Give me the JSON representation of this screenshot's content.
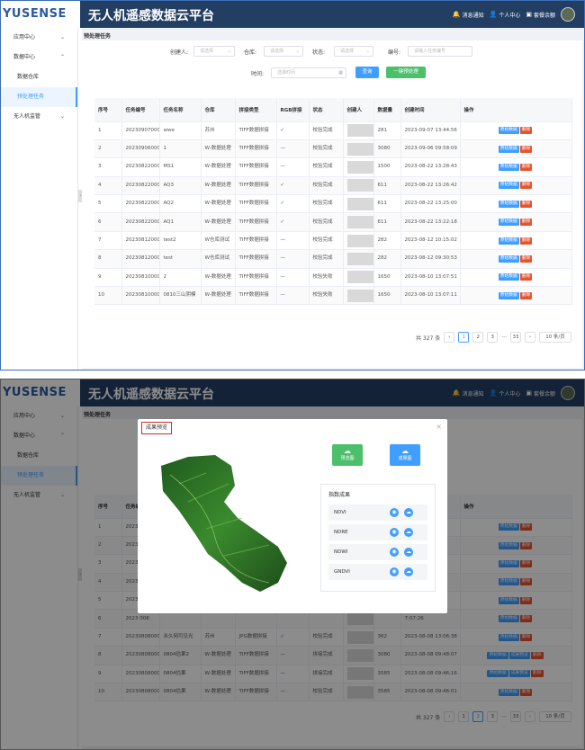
{
  "app": {
    "logo": "YUSENSE",
    "title": "无人机遥感数据云平台"
  },
  "header": {
    "notify": "消息通知",
    "personal": "个人中心",
    "account": "套餐余额"
  },
  "sidebar": {
    "app_center": "应用中心",
    "data_center": "数据中心",
    "warehouse": "数据仓库",
    "pretask": "预处理任务",
    "uav_monitor": "无人机监管"
  },
  "page": {
    "breadcrumb": "预处理任务"
  },
  "filters": {
    "creator_label": "创建人:",
    "creator_placeholder": "请选择",
    "warehouse_label": "仓库:",
    "warehouse_placeholder": "请选择",
    "status_label": "状态:",
    "status_placeholder": "请选择",
    "id_label": "编号:",
    "id_placeholder": "请输入任务编号",
    "time_label": "时间:",
    "time_placeholder": "选择时间",
    "query": "查询",
    "one_click": "一键预处理"
  },
  "table": {
    "headers": [
      "序号",
      "任务编号",
      "任务名称",
      "仓库",
      "拼接类型",
      "RGB拼接",
      "状态",
      "创建人",
      "数据量",
      "创建时间",
      "操作"
    ],
    "rows": [
      {
        "no": "1",
        "id": "202309070001",
        "name": "wwe",
        "wh": "苏州",
        "type": "TIFF数据拼接",
        "rgb": "✓",
        "status": "校验完成",
        "count": "281",
        "time": "2023-09-07 13:44:56"
      },
      {
        "no": "2",
        "id": "202309060001",
        "name": "1",
        "wh": "W-数据处理",
        "type": "TIFF数据拼接",
        "rgb": "—",
        "status": "校验完成",
        "count": "3080",
        "time": "2023-09-06 09:58:09"
      },
      {
        "no": "3",
        "id": "202308220004",
        "name": "MS1",
        "wh": "W-数据处理",
        "type": "TIFF数据拼接",
        "rgb": "—",
        "status": "校验完成",
        "count": "1500",
        "time": "2023-08-22 13:28:43"
      },
      {
        "no": "4",
        "id": "202308220003",
        "name": "AQ3",
        "wh": "W-数据处理",
        "type": "TIFF数据拼接",
        "rgb": "✓",
        "status": "校验完成",
        "count": "611",
        "time": "2023-08-22 13:26:42"
      },
      {
        "no": "5",
        "id": "202308220002",
        "name": "AQ2",
        "wh": "W-数据处理",
        "type": "TIFF数据拼接",
        "rgb": "✓",
        "status": "校验完成",
        "count": "611",
        "time": "2023-08-22 13:25:00"
      },
      {
        "no": "6",
        "id": "202308220001",
        "name": "AQ1",
        "wh": "W-数据处理",
        "type": "TIFF数据拼接",
        "rgb": "✓",
        "status": "校验完成",
        "count": "611",
        "time": "2023-08-22 13:22:18"
      },
      {
        "no": "7",
        "id": "202308120002",
        "name": "test2",
        "wh": "W仓库测试",
        "type": "TIFF数据拼接",
        "rgb": "—",
        "status": "校验完成",
        "count": "282",
        "time": "2023-08-12 10:15:02"
      },
      {
        "no": "8",
        "id": "202308120001",
        "name": "test",
        "wh": "W仓库测试",
        "type": "TIFF数据拼接",
        "rgb": "—",
        "status": "校验完成",
        "count": "282",
        "time": "2023-08-12 09:30:53"
      },
      {
        "no": "9",
        "id": "202308100003",
        "name": "2",
        "wh": "W-数据处理",
        "type": "TIFF数据拼接",
        "rgb": "—",
        "status": "校验失败",
        "count": "1650",
        "time": "2023-08-10 13:07:51"
      },
      {
        "no": "10",
        "id": "202308100002",
        "name": "0810三山阴模",
        "wh": "W-数据处理",
        "type": "TIFF数据拼接",
        "rgb": "—",
        "status": "校验失败",
        "count": "1650",
        "time": "2023-08-10 13:07:11"
      }
    ],
    "op_raw": "原始数据",
    "op_delete": "删除"
  },
  "pagination": {
    "total": "共 327 条",
    "pages": [
      "1",
      "2",
      "3",
      "33"
    ],
    "ellipsis": "···",
    "size": "10 条/页"
  },
  "table2": {
    "rows": [
      {
        "no": "1",
        "id": "2023\n015",
        "time": "13:06:04"
      },
      {
        "no": "2",
        "id": "2023\n015",
        "time": "6:09:35"
      },
      {
        "no": "3",
        "id": "2023\n012",
        "time": "3:31:39"
      },
      {
        "no": "4",
        "id": "2023\n010",
        "time": "3:09:06"
      },
      {
        "no": "5",
        "id": "2023\n009",
        "time": "3:08:38"
      },
      {
        "no": "6",
        "id": "2023\n008",
        "time": "7:07:26"
      },
      {
        "no": "7",
        "id": "202308080007",
        "name": "永久网可见光",
        "wh": "苏州",
        "type": "JPG数据拼接",
        "rgb": "✓",
        "status": "校验完成",
        "count": "362",
        "time": "2023-08-08 13:06:38"
      },
      {
        "no": "8",
        "id": "202308080006",
        "name": "0804估果2",
        "wh": "W-数据处理",
        "type": "TIFF数据拼接",
        "rgb": "—",
        "status": "拼接完成",
        "count": "3080",
        "time": "2023-08-08 09:48:07"
      },
      {
        "no": "9",
        "id": "202308080005",
        "name": "0804估果",
        "wh": "W-数据处理",
        "type": "TIFF数据拼接",
        "rgb": "—",
        "status": "拼接完成",
        "count": "3585",
        "time": "2023-08-08 09:46:16"
      },
      {
        "no": "10",
        "id": "202308080004",
        "name": "0804估果",
        "wh": "W-数据处理",
        "type": "TIFF数据拼接",
        "rgb": "—",
        "status": "校验完成",
        "count": "3585",
        "time": "2023-08-08 09:46:01"
      }
    ],
    "op_result": "成果预览"
  },
  "modal": {
    "title": "成果预览",
    "preview_btn": "预览图",
    "result_btn": "成果图",
    "index_title": "指数成果",
    "indices": [
      "NDVI",
      "NDRE",
      "NDWI",
      "GNDVI"
    ]
  },
  "colors": {
    "header": "#233e63",
    "accent": "#409eff",
    "danger": "#e6532e",
    "success": "#4cbf6b"
  }
}
